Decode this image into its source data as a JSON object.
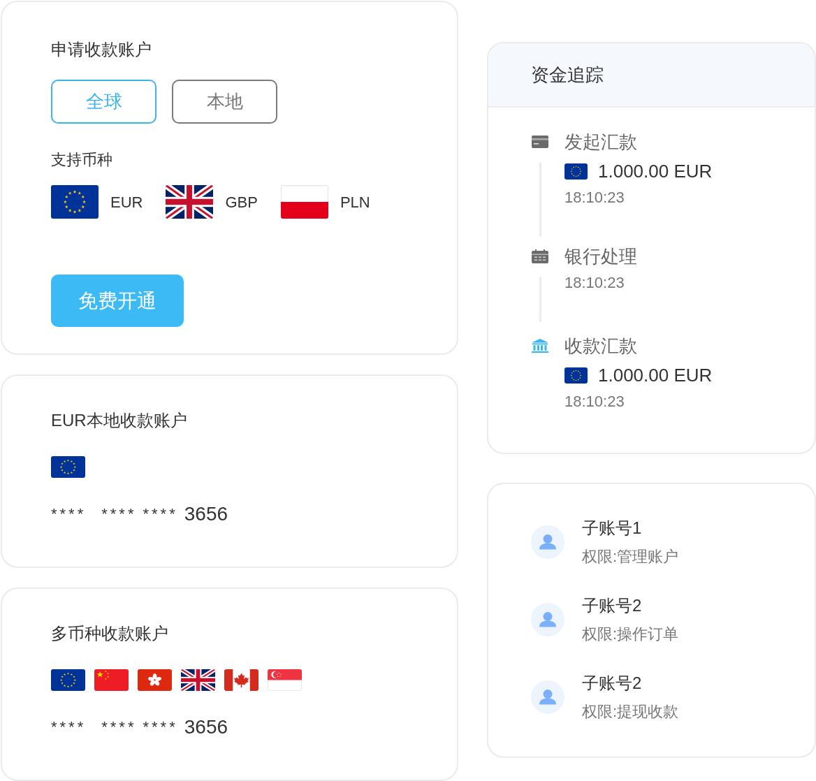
{
  "apply_card": {
    "title": "申请收款账户",
    "regions": [
      {
        "label": "全球",
        "selected": true
      },
      {
        "label": "本地",
        "selected": false
      }
    ],
    "currencies_label": "支持币种",
    "currencies": [
      {
        "kind": "eu",
        "code": "EUR"
      },
      {
        "kind": "gb",
        "code": "GBP"
      },
      {
        "kind": "pl",
        "code": "PLN"
      }
    ],
    "button": "免费开通"
  },
  "local_account": {
    "title": "EUR本地收款账户",
    "flags": [
      {
        "kind": "eu"
      }
    ],
    "mask_groups": [
      "****",
      "****",
      "****"
    ],
    "last_digits": "3656"
  },
  "multi_account": {
    "title": "多币种收款账户",
    "flags": [
      {
        "kind": "eu"
      },
      {
        "kind": "cn"
      },
      {
        "kind": "hk"
      },
      {
        "kind": "gb"
      },
      {
        "kind": "ca"
      },
      {
        "kind": "sg"
      }
    ],
    "mask_groups": [
      "****",
      "****",
      "****"
    ],
    "last_digits": "3656"
  },
  "tracking": {
    "title": "资金追踪",
    "steps": [
      {
        "kind": "card",
        "title": "发起汇款",
        "active": false,
        "amount": {
          "kind": "eu",
          "text": "1.000.00 EUR"
        },
        "time": "18:10:23"
      },
      {
        "kind": "calendar",
        "title": "银行处理",
        "active": false,
        "time": "18:10:23"
      },
      {
        "kind": "bank",
        "title": "收款汇款",
        "active": true,
        "amount": {
          "kind": "eu",
          "text": "1.000.00 EUR"
        },
        "time": "18:10:23"
      }
    ]
  },
  "sub_accounts": [
    {
      "name": "子账号1",
      "permission": "权限:管理账户"
    },
    {
      "name": "子账号2",
      "permission": "权限:操作订单"
    },
    {
      "name": "子账号2",
      "permission": "权限:提现收款"
    }
  ]
}
